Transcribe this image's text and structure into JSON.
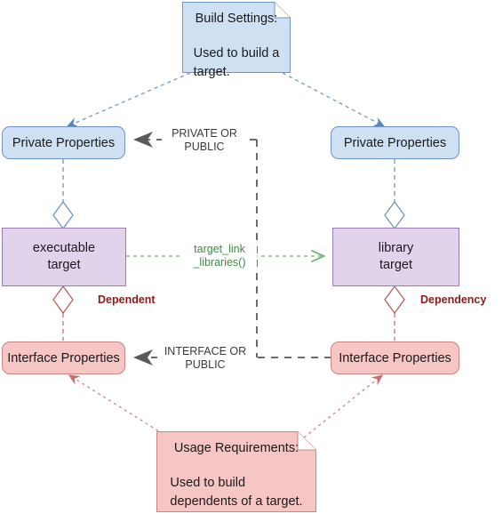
{
  "diagram": {
    "title": "CMake target properties and usage requirements diagram",
    "colors": {
      "blue_fill": "#cfe0f3",
      "blue_stroke": "#6f93c4",
      "red_fill": "#f5c6c4",
      "red_stroke": "#c98584",
      "purple_fill": "#e2d3ec",
      "purple_stroke": "#9a7cb0",
      "green_accent": "#3d8c40",
      "gray_dashed": "#6b6b6b",
      "role_text": "#8b1a1a"
    }
  },
  "nodes": {
    "build_settings_note": {
      "title": "Build Settings:",
      "body": "Used to build a\ntarget."
    },
    "usage_requirements_note": {
      "title": "Usage Requirements:",
      "body": "Used to build\ndependents of a target."
    },
    "private_properties_left": {
      "label": "Private Properties"
    },
    "private_properties_right": {
      "label": "Private Properties"
    },
    "interface_properties_left": {
      "label": "Interface Properties"
    },
    "interface_properties_right": {
      "label": "Interface Properties"
    },
    "executable_target": {
      "label": "executable\ntarget"
    },
    "library_target": {
      "label": "library\ntarget"
    }
  },
  "labels": {
    "private_or_public": "PRIVATE OR\nPUBLIC",
    "interface_or_public": "INTERFACE OR\nPUBLIC",
    "target_link_libraries": "target_link\n_libraries()",
    "dependent": "Dependent",
    "dependency": "Dependency"
  }
}
